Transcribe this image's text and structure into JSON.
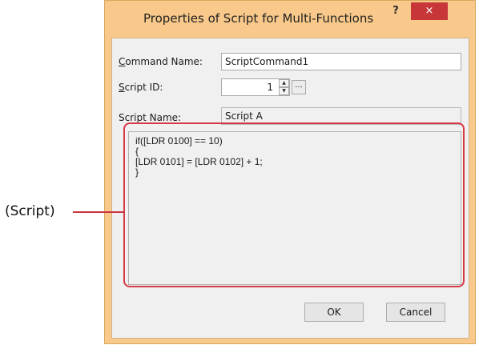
{
  "dialog": {
    "title": "Properties of Script for Multi-Functions",
    "help_label": "?",
    "close_label": "×",
    "command_name": {
      "label_first": "C",
      "label_rest": "ommand Name:",
      "value": "ScriptCommand1"
    },
    "script_id": {
      "label_first": "S",
      "label_rest": "cript ID:",
      "value": "1"
    },
    "script_name": {
      "label": "Script Name:",
      "value": "Script A"
    },
    "script_lines": [
      "if([LDR 0100] == 10)",
      "{",
      "[LDR 0101] = [LDR 0102] + 1;",
      "}"
    ],
    "browse_label": "...",
    "ok_label": "OK",
    "cancel_label": "Cancel"
  },
  "annotation": {
    "callout_label": "(Script)",
    "color": "#d63a47"
  },
  "colors": {
    "frame": "#f8c98a",
    "close": "#c7373a",
    "client": "#f0f0f0"
  }
}
